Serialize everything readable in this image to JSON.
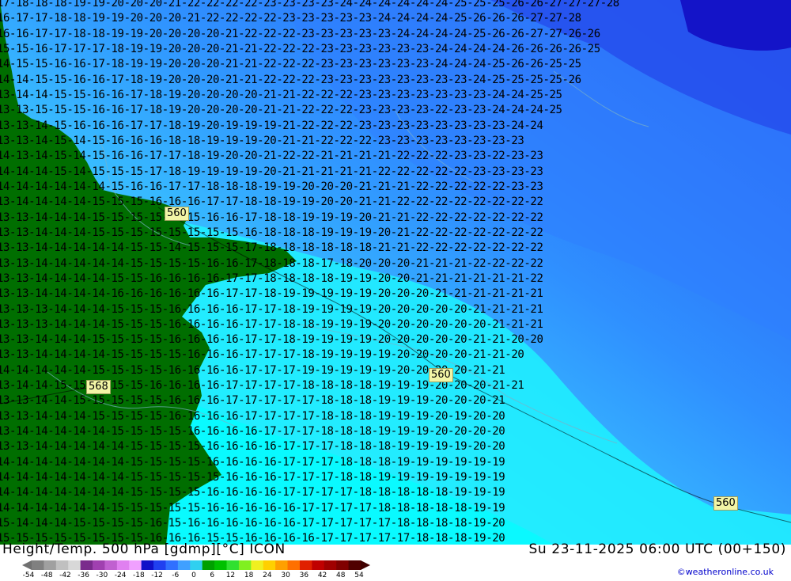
{
  "map": {
    "title": "Height/Temp. 500 hPa [gdmp][°C] ICON",
    "datetime": "Su 23-11-2025 06:00 UTC (00+150)",
    "credit": "©weatheronline.co.uk",
    "contour_labels": [
      {
        "text": "560"
      },
      {
        "text": "568"
      },
      {
        "text": "560"
      },
      {
        "text": "560"
      }
    ],
    "scale": {
      "ticks": [
        "-54",
        "-48",
        "-42",
        "-36",
        "-30",
        "-24",
        "-18",
        "-12",
        "-6",
        "0",
        "6",
        "12",
        "18",
        "24",
        "30",
        "36",
        "42",
        "48",
        "54"
      ],
      "colors": [
        "#808080",
        "#a0a0a0",
        "#c0c0c0",
        "#d8d8d8",
        "#7a2b8c",
        "#a040b0",
        "#c060d0",
        "#e080f0",
        "#f0a0ff",
        "#1010c8",
        "#2040f0",
        "#3070ff",
        "#40a0ff",
        "#30d0f0",
        "#00a000",
        "#00c000",
        "#30e030",
        "#80f020",
        "#f0f020",
        "#ffd000",
        "#ffa000",
        "#ff7000",
        "#e02000",
        "#c00000",
        "#a00000",
        "#800000",
        "#500000"
      ]
    },
    "temperature_rows": [
      "17 18 18 18 19 19 20 20 20 21 22 22 22 22 23 23 23 23 24 24 24 24 24 24 25 25 25 26 26 27 27 27 28",
      "16 17 17 18 18 19 19 20 20 20 21 22 22 22 22 23 23 23 23 23 24 24 24 24 25 26 26 26 27 27 28",
      "16 16 17 17 18 18 19 19 20 20 20 20 21 22 22 22 23 23 23 23 23 24 24 24 24 25 26 26 27 27 26 26",
      "15 15 16 17 17 17 18 19 19 20 20 20 21 21 22 22 22 23 23 23 23 23 23 24 24 24 24 26 26 26 26 25",
      "14 15 15 16 16 17 18 19 19 20 20 20 21 21 22 22 22 23 23 23 23 23 23 24 24 24 25 26 26 25 25",
      "14 14 15 15 16 16 17 18 19 20 20 20 21 21 22 22 22 23 23 23 23 23 23 23 23 24 25 25 25 25 26",
      "13 14 14 15 15 16 16 17 18 19 20 20 20 20 21 21 22 22 22 23 23 23 23 23 23 23 24 24 25 25",
      "13 13 15 15 15 16 16 17 18 19 20 20 20 20 21 21 22 22 22 23 23 23 23 22 23 23 24 24 24 25",
      "13 13 14 15 16 16 16 17 17 18 19 20 19 19 19 21 22 22 22 23 23 23 23 23 23 23 23 24 24",
      "13 13 14 15 14 15 16 16 16 18 18 19 19 19 20 21 21 22 22 22 23 23 23 23 23 23 23 23",
      "14 13 14 15 14 15 16 16 17 17 18 19 20 20 21 22 22 21 21 21 21 22 22 22 23 23 22 23 23",
      "14 14 14 15 14 15 15 15 17 18 19 19 19 19 20 21 21 21 21 21 22 22 22 22 22 23 23 23 23",
      "14 14 14 14 14 14 15 16 16 17 17 18 18 18 19 19 20 20 20 21 21 21 22 22 22 22 22 23 23",
      "13 14 14 14 14 15 15 15 16 16 16 17 17 18 18 19 19 20 20 21 21 22 22 22 22 22 22 22 22",
      "13 13 14 14 14 15 15 15 15 15 15 16 16 17 18 18 19 19 19 20 21 21 22 22 22 22 22 22 22",
      "13 13 14 14 14 15 15 15 15 15 15 15 15 16 18 18 18 19 19 19 20 21 22 22 22 22 22 22 22",
      "13 13 14 14 14 14 14 15 15 14 15 15 15 17 18 18 18 18 18 18 21 21 22 22 22 22 22 22 22",
      "13 13 14 14 14 14 14 15 15 15 15 16 16 17 18 18 18 17 18 20 20 20 21 21 21 22 22 22 22",
      "13 13 14 14 14 14 15 15 16 16 16 16 17 17 18 18 18 18 19 19 20 20 21 21 21 21 21 21 22",
      "13 13 14 14 14 14 16 16 16 16 16 16 17 17 18 19 19 19 19 19 20 20 20 21 21 21 21 21 21",
      "13 13 13 14 14 14 15 15 15 16 16 16 16 17 17 18 19 19 19 19 20 20 20 20 20 21 21 21 21",
      "13 13 13 14 14 14 15 15 15 16 16 16 16 17 17 18 18 19 19 19 20 20 20 20 20 20 21 21 21",
      "13 13 14 14 14 15 15 15 15 16 16 16 16 17 17 18 19 19 19 19 20 20 20 20 20 21 21 20 20",
      "13 13 14 14 14 14 15 15 15 15 16 16 16 17 17 17 18 19 19 19 19 20 20 20 20 21 21 20",
      "14 14 14 14 14 15 15 15 15 16 16 16 16 17 17 17 19 19 19 19 19 20 20 20 20 21 21",
      "13 14 14 15 15 15 15 15 16 16 16 16 17 17 17 17 18 18 18 18 19 19 19 20 20 20 21 21",
      "13 13 14 14 15 15 15 15 15 16 16 16 17 17 17 17 17 18 18 18 19 19 19 20 20 20 21",
      "13 13 14 14 14 15 15 15 15 16 16 16 16 17 17 17 17 18 18 18 19 19 19 20 19 20 20",
      "13 14 14 14 14 14 15 15 15 15 16 16 16 16 17 17 17 18 18 18 19 19 19 20 20 20 20",
      "13 13 14 14 14 14 14 15 15 15 15 16 16 16 16 17 17 17 18 18 18 19 19 19 19 20 20",
      "14 14 14 14 14 14 14 15 15 15 15 16 16 16 16 17 17 17 18 18 18 19 19 19 19 19 19",
      "14 14 14 14 14 14 14 15 15 15 15 15 16 16 16 17 17 17 18 18 19 19 19 19 19 19 19",
      "14 14 14 14 14 14 14 15 15 15 15 16 16 16 16 17 17 17 17 18 18 18 18 18 19 19 19",
      "14 14 14 14 14 14 15 15 15 15 15 16 16 16 16 16 17 17 17 17 18 18 18 18 18 19 19",
      "15 14 14 14 15 15 15 15 16 15 16 16 16 16 16 16 17 17 17 17 17 18 18 18 18 19 20",
      "15 15 15 15 15 15 15 15 16 16 16 15 15 16 16 16 16 17 17 17 17 17 18 18 18 19 20"
    ]
  }
}
